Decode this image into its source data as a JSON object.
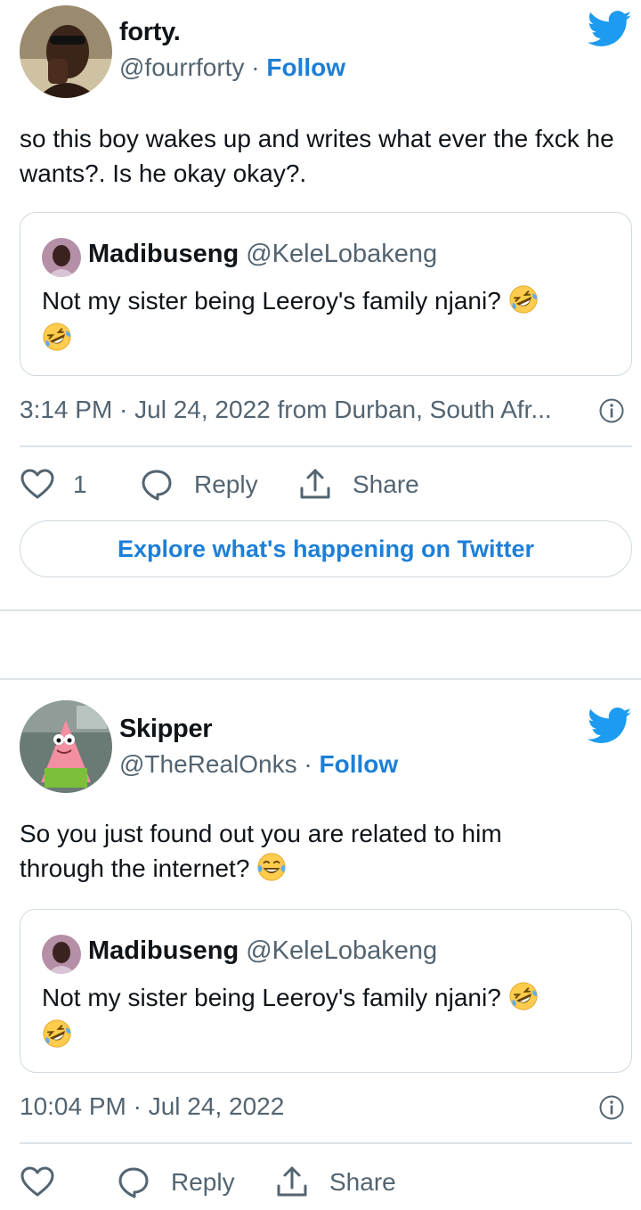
{
  "tweets": [
    {
      "name": "forty.",
      "handle": "@fourrforty",
      "follow_label": "Follow",
      "separator": "·",
      "text": "so this boy wakes up and writes what ever the fxck he wants?. Is he okay okay?.",
      "quote": {
        "name": "Madibuseng",
        "handle": "@KeleLobakeng",
        "text": "Not my sister being Leeroy's family njani?",
        "emoji": [
          "rolling-on-floor-laughing",
          "rolling-on-floor-laughing"
        ]
      },
      "time": "3:14 PM · Jul 24, 2022 from Durban, South Afr...",
      "likes": "1",
      "reply_label": "Reply",
      "share_label": "Share",
      "explore_label": "Explore what's happening on Twitter"
    },
    {
      "name": "Skipper",
      "handle": "@TheRealOnks",
      "follow_label": "Follow",
      "separator": "·",
      "text": "So you just found out you are related to him through the internet?",
      "text_emoji": "face-with-tears-of-joy",
      "quote": {
        "name": "Madibuseng",
        "handle": "@KeleLobakeng",
        "text": "Not my sister being Leeroy's family njani?",
        "emoji": [
          "rolling-on-floor-laughing",
          "rolling-on-floor-laughing"
        ]
      },
      "time": "10:04 PM · Jul 24, 2022",
      "reply_label": "Reply",
      "share_label": "Share"
    }
  ],
  "colors": {
    "accent": "#1d9bf0",
    "link": "#1d7fd6",
    "secondary_text": "#536471",
    "border": "#cfd9de"
  },
  "icons": [
    "twitter-bird-icon",
    "info-icon",
    "heart-icon",
    "reply-bubble-icon",
    "share-icon"
  ]
}
